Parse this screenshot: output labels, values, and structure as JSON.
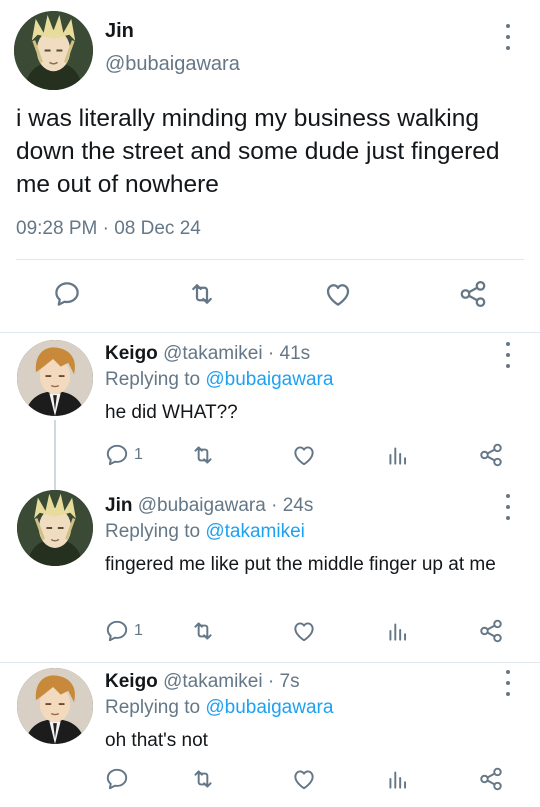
{
  "main_tweet": {
    "name": "Jin",
    "handle": "@bubaigawara",
    "text": "i was literally minding my business walking down the street and some dude just fingered me out of nowhere",
    "time": "09:28 PM",
    "dot": "·",
    "date": "08 Dec 24",
    "actions": [
      "comment-icon",
      "retweet-icon",
      "heart-icon",
      "share-icon"
    ]
  },
  "replies": [
    {
      "name": "Keigo",
      "handle": "@takamikei",
      "time": "· 41s",
      "replying_prefix": "Replying to ",
      "replying_to": "@bubaigawara",
      "text": "he did WHAT??",
      "reply_count": "1"
    },
    {
      "name": "Jin",
      "handle": "@bubaigawara",
      "time": "· 24s",
      "replying_prefix": "Replying to ",
      "replying_to": "@takamikei",
      "text": "fingered me like put the middle finger up at me",
      "reply_count": "1"
    },
    {
      "name": "Keigo",
      "handle": "@takamikei",
      "time": "· 7s",
      "replying_prefix": "Replying to ",
      "replying_to": "@bubaigawara",
      "text": "oh that's not",
      "reply_count": ""
    }
  ],
  "colors": {
    "icon": "#657786",
    "link": "#1da1f2",
    "divider": "#e1e8ed"
  }
}
